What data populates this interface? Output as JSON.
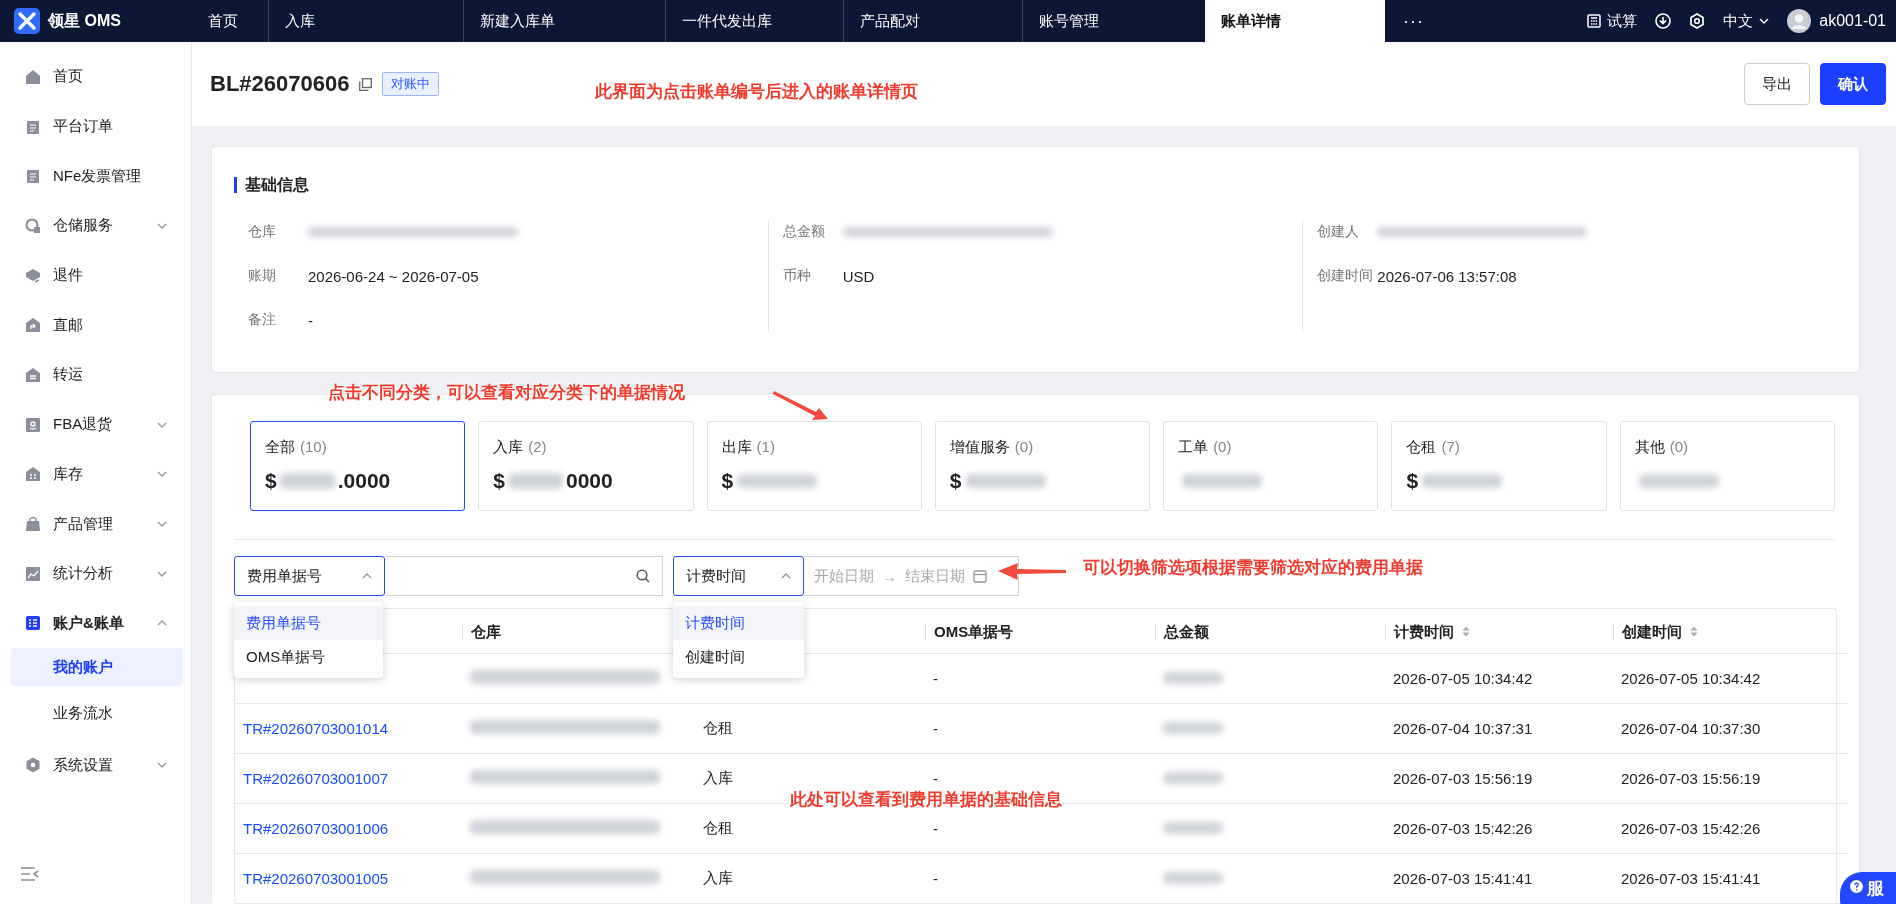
{
  "app": {
    "name": "领星 OMS"
  },
  "nav_tabs": [
    {
      "label": "首页",
      "selected": false
    },
    {
      "label": "入库",
      "selected": false
    },
    {
      "label": "新建入库单",
      "selected": false
    },
    {
      "label": "一件代发出库",
      "selected": false
    },
    {
      "label": "产品配对",
      "selected": false
    },
    {
      "label": "账号管理",
      "selected": false
    },
    {
      "label": "账单详情",
      "selected": true
    }
  ],
  "more_tabs": "···",
  "top_actions": {
    "calculator": "试算",
    "language": "中文",
    "user": "ak001-01"
  },
  "sidebar": {
    "items": [
      {
        "label": "首页",
        "selected": false
      },
      {
        "label": "平台订单",
        "selected": false
      },
      {
        "label": "NFe发票管理",
        "selected": false
      },
      {
        "label": "仓储服务",
        "selected": false,
        "expanded": false
      },
      {
        "label": "退件",
        "selected": false
      },
      {
        "label": "直邮",
        "selected": false
      },
      {
        "label": "转运",
        "selected": false
      },
      {
        "label": "FBA退货",
        "selected": false,
        "expanded": false
      },
      {
        "label": "库存",
        "selected": false,
        "expanded": false
      },
      {
        "label": "产品管理",
        "selected": false,
        "expanded": false
      },
      {
        "label": "统计分析",
        "selected": false,
        "expanded": false
      },
      {
        "label": "账户&账单",
        "selected": true,
        "expanded": true,
        "children": [
          {
            "label": "我的账户",
            "selected": true
          },
          {
            "label": "业务流水",
            "selected": false
          }
        ]
      },
      {
        "label": "系统设置",
        "selected": false,
        "expanded": false
      }
    ]
  },
  "header": {
    "bill_no": "BL#26070606",
    "status": "对账中",
    "buttons": [
      {
        "label": "导出",
        "kind": "secondary"
      },
      {
        "label": "确认",
        "kind": "primary"
      }
    ]
  },
  "basic_info": {
    "title": "基础信息",
    "columns": [
      [
        {
          "label": "仓库",
          "redacted": true
        },
        {
          "label": "账期",
          "value": "2026-06-24 ~ 2026-07-05"
        },
        {
          "label": "备注",
          "value": "-"
        }
      ],
      [
        {
          "label": "总金额",
          "redacted": true
        },
        {
          "label": "币种",
          "value": "USD"
        }
      ],
      [
        {
          "label": "创建人",
          "redacted": true
        },
        {
          "label": "创建时间",
          "value": "2026-07-06 13:57:08"
        }
      ]
    ]
  },
  "categories": [
    {
      "label": "全部",
      "count": "(10)",
      "selected": true,
      "prefix": "$",
      "suffix": ".0000"
    },
    {
      "label": "入库",
      "count": "(2)",
      "selected": false,
      "prefix": "$",
      "suffix": "0000"
    },
    {
      "label": "出库",
      "count": "(1)",
      "selected": false,
      "prefix": "$"
    },
    {
      "label": "增值服务",
      "count": "(0)",
      "selected": false,
      "prefix": "$"
    },
    {
      "label": "工单",
      "count": "(0)",
      "selected": false
    },
    {
      "label": "仓租",
      "count": "(7)",
      "selected": false,
      "prefix": "$"
    },
    {
      "label": "其他",
      "count": "(0)",
      "selected": false
    }
  ],
  "filters": {
    "search_by": {
      "value": "费用单据号",
      "options": [
        {
          "label": "费用单据号",
          "selected": true
        },
        {
          "label": "OMS单据号",
          "selected": false
        }
      ]
    },
    "time_by": {
      "value": "计费时间",
      "options": [
        {
          "label": "计费时间",
          "selected": true
        },
        {
          "label": "创建时间",
          "selected": false
        }
      ]
    },
    "date_range": {
      "start_placeholder": "开始日期",
      "separator": "→",
      "end_placeholder": "结束日期"
    }
  },
  "table": {
    "columns": [
      {
        "kind": "covered"
      },
      {
        "kind": "header",
        "label": "仓库",
        "sortable": false
      },
      {
        "kind": "covered"
      },
      {
        "kind": "header",
        "label": "OMS单据号",
        "sortable": false
      },
      {
        "kind": "header",
        "label": "总金额",
        "sortable": false
      },
      {
        "kind": "header",
        "label": "计费时间",
        "sortable": true
      },
      {
        "kind": "header",
        "label": "创建时间",
        "sortable": true
      }
    ],
    "rows": [
      {
        "warehouse_redacted": true,
        "oms_no": "-",
        "amount_redacted": true,
        "billing_time": "2026-07-05 10:34:42",
        "created_time": "2026-07-05 10:34:42"
      },
      {
        "id": "TR#20260703001014",
        "warehouse_redacted": true,
        "type": "仓租",
        "oms_no": "-",
        "amount_redacted": true,
        "billing_time": "2026-07-04 10:37:31",
        "created_time": "2026-07-04 10:37:30"
      },
      {
        "id": "TR#20260703001007",
        "warehouse_redacted": true,
        "type": "入库",
        "oms_no": "-",
        "amount_redacted": true,
        "billing_time": "2026-07-03 15:56:19",
        "created_time": "2026-07-03 15:56:19"
      },
      {
        "id": "TR#20260703001006",
        "warehouse_redacted": true,
        "type": "仓租",
        "oms_no": "-",
        "amount_redacted": true,
        "billing_time": "2026-07-03 15:42:26",
        "created_time": "2026-07-03 15:42:26"
      },
      {
        "id": "TR#20260703001005",
        "warehouse_redacted": true,
        "type": "入库",
        "oms_no": "-",
        "amount_redacted": true,
        "billing_time": "2026-07-03 15:41:41",
        "created_time": "2026-07-03 15:41:41"
      }
    ]
  },
  "annotations": [
    {
      "text": "此界面为点击账单编号后进入的账单详情页",
      "kind": "plain"
    },
    {
      "text": "点击不同分类，可以查看对应分类下的单据情况",
      "kind": "arrow-down"
    },
    {
      "text": "可以切换筛选项根据需要筛选对应的费用单据",
      "kind": "arrow-left"
    },
    {
      "text": "此处可以查看到费用单据的基础信息",
      "kind": "plain"
    }
  ],
  "service_button": {
    "label": "服"
  }
}
